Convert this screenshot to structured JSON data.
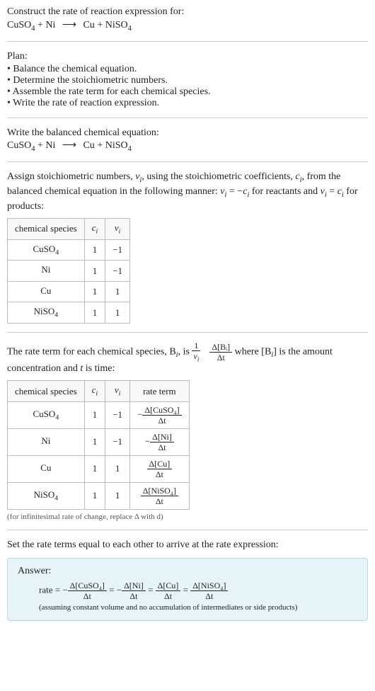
{
  "header": {
    "prompt": "Construct the rate of reaction expression for:",
    "equation_lhs1": "CuSO",
    "equation_lhs1_sub": "4",
    "equation_lhs2": "Ni",
    "equation_rhs1": "Cu",
    "equation_rhs2": "NiSO",
    "equation_rhs2_sub": "4"
  },
  "plan": {
    "title": "Plan:",
    "items": [
      "Balance the chemical equation.",
      "Determine the stoichiometric numbers.",
      "Assemble the rate term for each chemical species.",
      "Write the rate of reaction expression."
    ]
  },
  "balanced": {
    "title": "Write the balanced chemical equation:"
  },
  "assign": {
    "text_pre": "Assign stoichiometric numbers, ",
    "nu": "ν",
    "text_mid1": ", using the stoichiometric coefficients, ",
    "c": "c",
    "text_mid2": ", from the balanced chemical equation in the following manner: ",
    "rel1": " = −",
    "text_mid3": " for reactants and ",
    "rel2": " = ",
    "text_end": " for products:"
  },
  "table1": {
    "headers": [
      "chemical species",
      "cᵢ",
      "νᵢ"
    ],
    "rows": [
      {
        "species": "CuSO",
        "sub": "4",
        "c": "1",
        "nu": "−1"
      },
      {
        "species": "Ni",
        "sub": "",
        "c": "1",
        "nu": "−1"
      },
      {
        "species": "Cu",
        "sub": "",
        "c": "1",
        "nu": "1"
      },
      {
        "species": "NiSO",
        "sub": "4",
        "c": "1",
        "nu": "1"
      }
    ]
  },
  "rateterm": {
    "pre": "The rate term for each chemical species, B",
    "mid1": ", is ",
    "frac1_num": "1",
    "frac1_den": "νᵢ",
    "frac2_num": "Δ[Bᵢ]",
    "frac2_den": "Δt",
    "mid2": " where [B",
    "mid3": "] is the amount concentration and ",
    "tvar": "t",
    "end": " is time:"
  },
  "table2": {
    "headers": [
      "chemical species",
      "cᵢ",
      "νᵢ",
      "rate term"
    ],
    "rows": [
      {
        "species": "CuSO",
        "sub": "4",
        "c": "1",
        "nu": "−1",
        "neg": "−",
        "num": "Δ[CuSO₄]",
        "den": "Δt"
      },
      {
        "species": "Ni",
        "sub": "",
        "c": "1",
        "nu": "−1",
        "neg": "−",
        "num": "Δ[Ni]",
        "den": "Δt"
      },
      {
        "species": "Cu",
        "sub": "",
        "c": "1",
        "nu": "1",
        "neg": "",
        "num": "Δ[Cu]",
        "den": "Δt"
      },
      {
        "species": "NiSO",
        "sub": "4",
        "c": "1",
        "nu": "1",
        "neg": "",
        "num": "Δ[NiSO₄]",
        "den": "Δt"
      }
    ],
    "note": "(for infinitesimal rate of change, replace Δ with d)"
  },
  "final": {
    "title": "Set the rate terms equal to each other to arrive at the rate expression:"
  },
  "answer": {
    "label": "Answer:",
    "lhs": "rate = ",
    "terms": [
      {
        "neg": "−",
        "num": "Δ[CuSO₄]",
        "den": "Δt"
      },
      {
        "neg": "−",
        "num": "Δ[Ni]",
        "den": "Δt"
      },
      {
        "neg": "",
        "num": "Δ[Cu]",
        "den": "Δt"
      },
      {
        "neg": "",
        "num": "Δ[NiSO₄]",
        "den": "Δt"
      }
    ],
    "eq": " = ",
    "assume": "(assuming constant volume and no accumulation of intermediates or side products)"
  }
}
